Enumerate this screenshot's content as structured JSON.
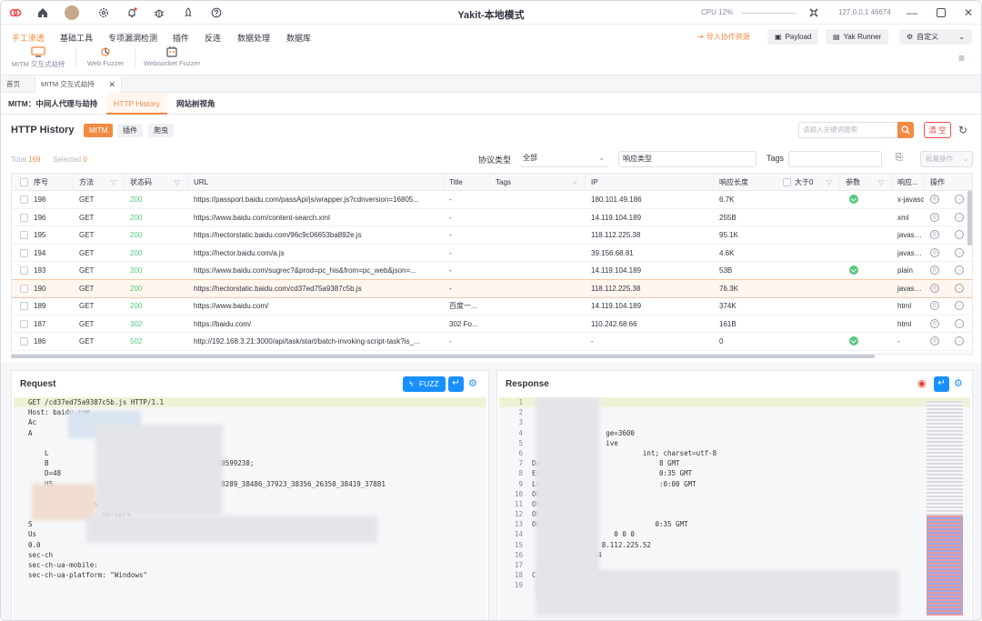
{
  "app": {
    "title": "Yakit-本地模式",
    "cpu": "CPU 12%",
    "ip_port": "127.0.0.1 46674"
  },
  "menu": {
    "items": [
      "手工渗透",
      "基础工具",
      "专项漏洞检测",
      "插件",
      "反连",
      "数据处理",
      "数据库"
    ],
    "tools": [
      "MITM 交互式劫持",
      "Web Fuzzer",
      "Websocket Fuzzer"
    ],
    "right": {
      "import": "导入协作资源",
      "payload": "Payload",
      "yakrunner": "Yak Runner",
      "custom": "自定义"
    }
  },
  "page_tabs": {
    "home": "首页",
    "mitm": "MITM 交互式劫持"
  },
  "sub_tabs": {
    "mitm": "MITM：中间人代理与劫持",
    "history": "HTTP History",
    "site": "网站树视角"
  },
  "history": {
    "title": "HTTP History",
    "filters": [
      "MITM",
      "插件",
      "爬虫"
    ],
    "search_placeholder": "请输入关键词搜索",
    "clear": "清 空",
    "total_label": "Total",
    "total": "169",
    "selected_label": "Selected",
    "selected": "0",
    "protocol_label": "协议类型",
    "protocol_value": "全部",
    "response_type_label": "响应类型",
    "tags_label": "Tags",
    "batch": "批量操作",
    "columns": [
      "序号",
      "方法",
      "状态码",
      "URL",
      "Title",
      "Tags",
      "IP",
      "响应长度",
      "大于0",
      "参数",
      "响应...",
      "操作"
    ],
    "rows": [
      {
        "id": "198",
        "method": "GET",
        "status": "200",
        "url": "https://passport.baidu.com/passApi/js/wrapper.js?cdnversion=16805...",
        "title": "-",
        "ip": "180.101.49.186",
        "len": "6.7K",
        "param": true,
        "type": "x-javasc"
      },
      {
        "id": "196",
        "method": "GET",
        "status": "200",
        "url": "https://www.baidu.com/content-search.xml",
        "title": "-",
        "ip": "14.119.104.189",
        "len": "255B",
        "param": false,
        "type": "xml"
      },
      {
        "id": "195",
        "method": "GET",
        "status": "200",
        "url": "https://hectorstatic.baidu.com/96c9c06653ba892e.js",
        "title": "-",
        "ip": "118.112.225.38",
        "len": "95.1K",
        "param": false,
        "type": "javascrip"
      },
      {
        "id": "194",
        "method": "GET",
        "status": "200",
        "url": "https://hector.baidu.com/a.js",
        "title": "-",
        "ip": "39.156.68.81",
        "len": "4.6K",
        "param": false,
        "type": "javascrip"
      },
      {
        "id": "193",
        "method": "GET",
        "status": "200",
        "url": "https://www.baidu.com/sugrec?&prod=pc_his&from=pc_web&json=...",
        "title": "-",
        "ip": "14.119.104.189",
        "len": "53B",
        "param": true,
        "type": "plain"
      },
      {
        "id": "190",
        "method": "GET",
        "status": "200",
        "url": "https://hectorstatic.baidu.com/cd37ed75a9387c5b.js",
        "title": "-",
        "ip": "118.112.225.38",
        "len": "76.3K",
        "param": false,
        "type": "javascrip"
      },
      {
        "id": "189",
        "method": "GET",
        "status": "200",
        "url": "https://www.baidu.com/",
        "title": "百度一...",
        "ip": "14.119.104.189",
        "len": "374K",
        "param": false,
        "type": "html"
      },
      {
        "id": "187",
        "method": "GET",
        "status": "302",
        "url": "https://baidu.com/",
        "title": "302 Fo...",
        "ip": "110.242.68.66",
        "len": "161B",
        "param": false,
        "type": "html"
      },
      {
        "id": "186",
        "method": "GET",
        "status": "502",
        "url": "http://192.168.3.21:3000/api/task/start/batch-invoking-script-task?is_...",
        "title": "-",
        "ip": "-",
        "len": "0",
        "param": true,
        "type": "-"
      }
    ]
  },
  "request": {
    "title": "Request",
    "fuzz": "FUZZ",
    "lines": [
      "GET /cd37ed75a9387c5b.js HTTP/1.1",
      "Host: baidu.com",
      "Ac",
      "A",
      "",
      "    L",
      "    B                            8225; PSTM=1680599238;",
      "    D=48                          =1;",
      "    H5                   .baidu.com/     3468_38289_38486_37923_38356_26350_38419_37881",
      "                  .baidu.com/",
      "                st: script",
      "                  no-cors",
      "S",
      "Us                          0; Win64; x64) AppleWebKi                    rome/111.0.",
      "0.0",
      "sec-ch",
      "sec-ch-ua-mobile:",
      "sec-ch-ua-platform: \"Windows\""
    ]
  },
  "response": {
    "title": "Response",
    "lines": [
      {
        "n": "1",
        "t": ""
      },
      {
        "n": "2",
        "t": ""
      },
      {
        "n": "3",
        "t": ""
      },
      {
        "n": "4",
        "t": "                  ge=3600"
      },
      {
        "n": "5",
        "t": "                  ive"
      },
      {
        "n": "6",
        "t": "                           int; charset=utf-8"
      },
      {
        "n": "7",
        "t": "Date: Tu                       8 GMT"
      },
      {
        "n": "8",
        "t": "Expi                           0:35 GMT"
      },
      {
        "n": "9",
        "t": "Las                            :0:00 GMT"
      },
      {
        "n": "10",
        "t": "Ohc-Ca"
      },
      {
        "n": "11",
        "t": "Ohc"
      },
      {
        "n": "12",
        "t": "Oh"
      },
      {
        "n": "13",
        "t": "Ohc                           0:35 GMT"
      },
      {
        "n": "14",
        "t": "                    0 0 0"
      },
      {
        "n": "15",
        "t": "                 8.112.225.52"
      },
      {
        "n": "16",
        "t": "              .14"
      },
      {
        "n": "17",
        "t": "              IT"
      },
      {
        "n": "18",
        "t": "C              78155"
      },
      {
        "n": "19",
        "t": ""
      }
    ]
  },
  "colors": {
    "accent": "#f28b44",
    "green": "#56c87b",
    "blue": "#1890ff",
    "red": "#f34a4a"
  }
}
